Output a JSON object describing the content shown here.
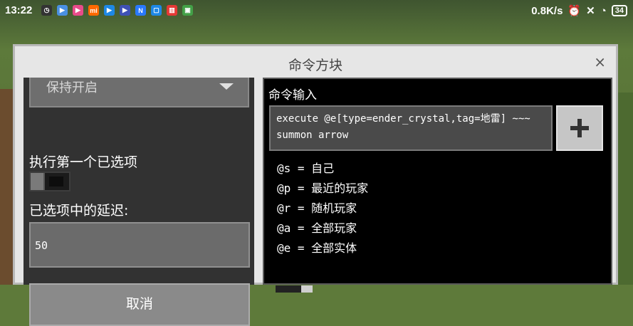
{
  "status_bar": {
    "time": "13:22",
    "network_speed": "0.8K/s",
    "battery": "34",
    "app_icons": [
      {
        "name": "clock-notif-icon",
        "color": "#333333",
        "glyph": "◷"
      },
      {
        "name": "youtube-icon",
        "color": "#4a90e2",
        "glyph": "▶"
      },
      {
        "name": "video-app-icon",
        "color": "#e84b8a",
        "glyph": "▶"
      },
      {
        "name": "mi-icon",
        "color": "#ff6900",
        "glyph": "mi"
      },
      {
        "name": "music-app-icon",
        "color": "#1e88e5",
        "glyph": "▶"
      },
      {
        "name": "video-app2-icon",
        "color": "#3f51b5",
        "glyph": "▶"
      },
      {
        "name": "n-app-icon",
        "color": "#2979ff",
        "glyph": "N"
      },
      {
        "name": "files-app-icon",
        "color": "#1e88e5",
        "glyph": "▢"
      },
      {
        "name": "store-app-icon",
        "color": "#e53935",
        "glyph": "▥"
      },
      {
        "name": "store2-app-icon",
        "color": "#43a047",
        "glyph": "▣"
      }
    ]
  },
  "dialog": {
    "title": "命令方块",
    "close": "×"
  },
  "left": {
    "dropdown_value": "保持开启",
    "execute_first_label": "执行第一个已选项",
    "delay_label": "已选项中的延迟:",
    "delay_value": "50",
    "cancel_label": "取消"
  },
  "right": {
    "command_label": "命令输入",
    "command_text": "execute @e[type=ender_crystal,tag=地雷] ~~~\nsummon arrow",
    "selectors": [
      "@s = 自己",
      "@p = 最近的玩家",
      "@r = 随机玩家",
      "@a = 全部玩家",
      "@e = 全部实体"
    ]
  }
}
